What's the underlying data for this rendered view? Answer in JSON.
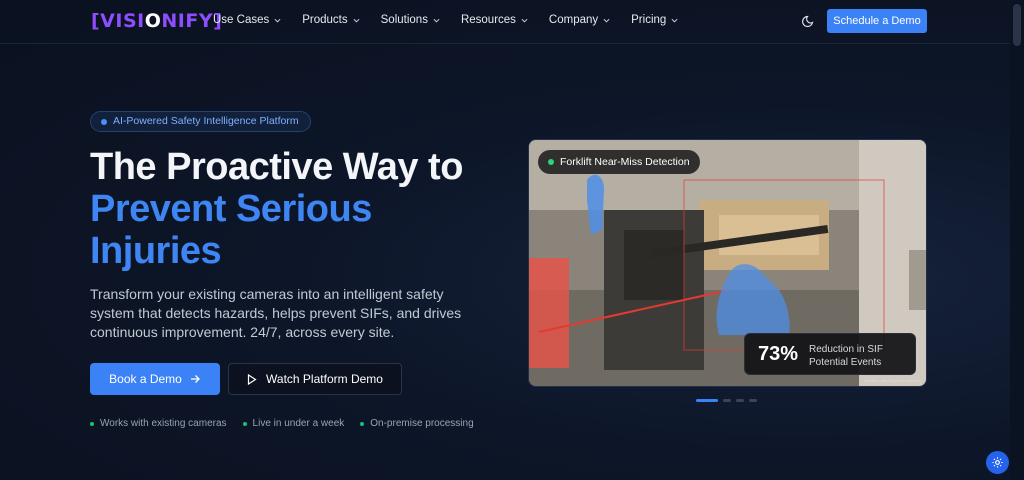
{
  "brand": {
    "logo_left": "[VISI",
    "logo_eye": "O",
    "logo_right": "NIFY]"
  },
  "nav": {
    "items": [
      {
        "label": "Use Cases"
      },
      {
        "label": "Products"
      },
      {
        "label": "Solutions"
      },
      {
        "label": "Resources"
      },
      {
        "label": "Company"
      },
      {
        "label": "Pricing"
      }
    ],
    "theme_icon": "moon-icon",
    "cta_label": "Schedule a Demo"
  },
  "hero": {
    "badge": "AI-Powered Safety Intelligence Platform",
    "title_line1": "The Proactive Way to",
    "title_line2": "Prevent Serious",
    "title_line3": "Injuries",
    "subtitle": "Transform your existing cameras into an intelligent safety system that detects hazards, helps prevent SIFs, and drives continuous improvement. 24/7, across every site.",
    "primary_cta": "Book a Demo",
    "secondary_cta": "Watch Platform Demo",
    "features": [
      "Works with existing cameras",
      "Live in under a week",
      "On-premise processing"
    ]
  },
  "visual": {
    "detection_label": "Forklift Near-Miss Detection",
    "stat_value": "73%",
    "stat_label": "Reduction in SIF Potential Events",
    "watermark": "Modified with Segment Anything",
    "carousel": {
      "count": 4,
      "active_index": 0
    }
  },
  "colors": {
    "accent": "#3b82f6",
    "brand_purple": "#8e4dff",
    "bg": "#0d1628",
    "success": "#18c07a"
  },
  "settings_icon": "gear-icon"
}
